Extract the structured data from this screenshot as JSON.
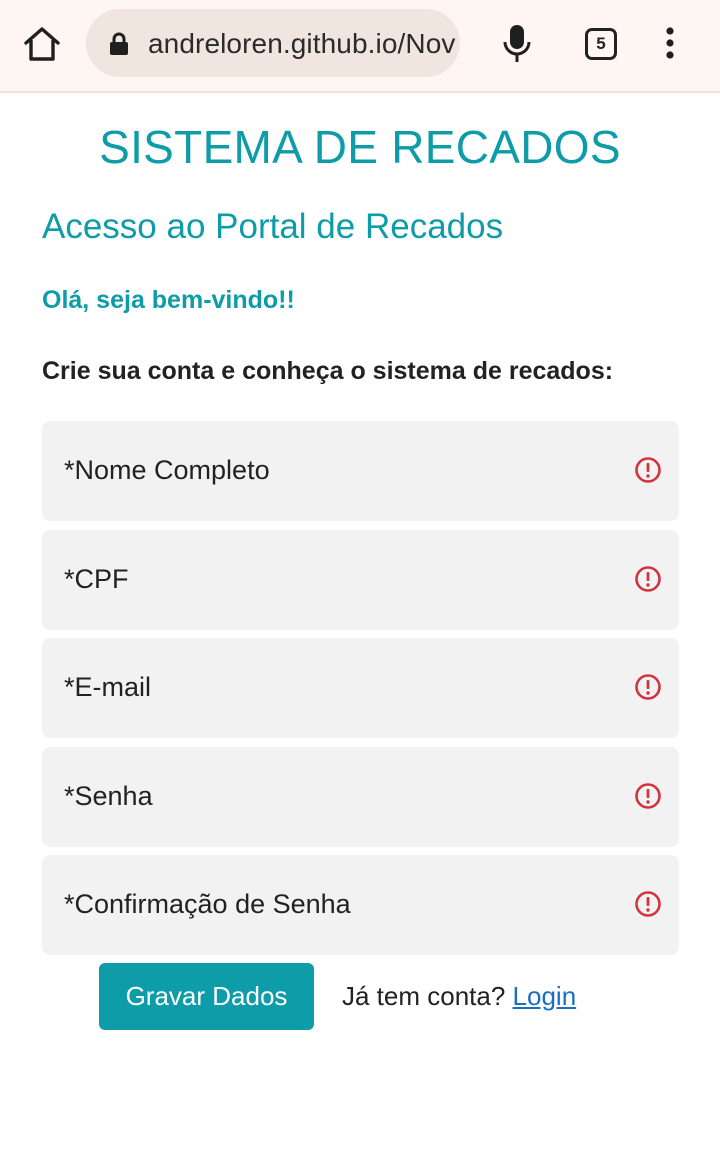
{
  "browser": {
    "url": "andreloren.github.io/Nov",
    "tab_count": "5"
  },
  "page": {
    "title": "SISTEMA DE RECADOS",
    "subtitle": "Acesso ao Portal de Recados",
    "welcome": "Olá, seja bem-vindo!!",
    "instruction": "Crie sua conta e conheça o sistema de recados:"
  },
  "form": {
    "fields": [
      {
        "label": "*Nome Completo",
        "icon": "alert-circle-icon"
      },
      {
        "label": "*CPF",
        "icon": "alert-circle-icon"
      },
      {
        "label": "*E-mail",
        "icon": "alert-circle-icon"
      },
      {
        "label": "*Senha",
        "icon": "alert-circle-icon"
      },
      {
        "label": "*Confirmação de Senha",
        "icon": "alert-circle-icon"
      }
    ],
    "save_label": "Gravar Dados",
    "account_prompt": "Já tem conta?",
    "login_label": "Login"
  },
  "colors": {
    "accent": "#0e9ca8",
    "alert": "#d0343f",
    "link": "#1a6fc4"
  }
}
